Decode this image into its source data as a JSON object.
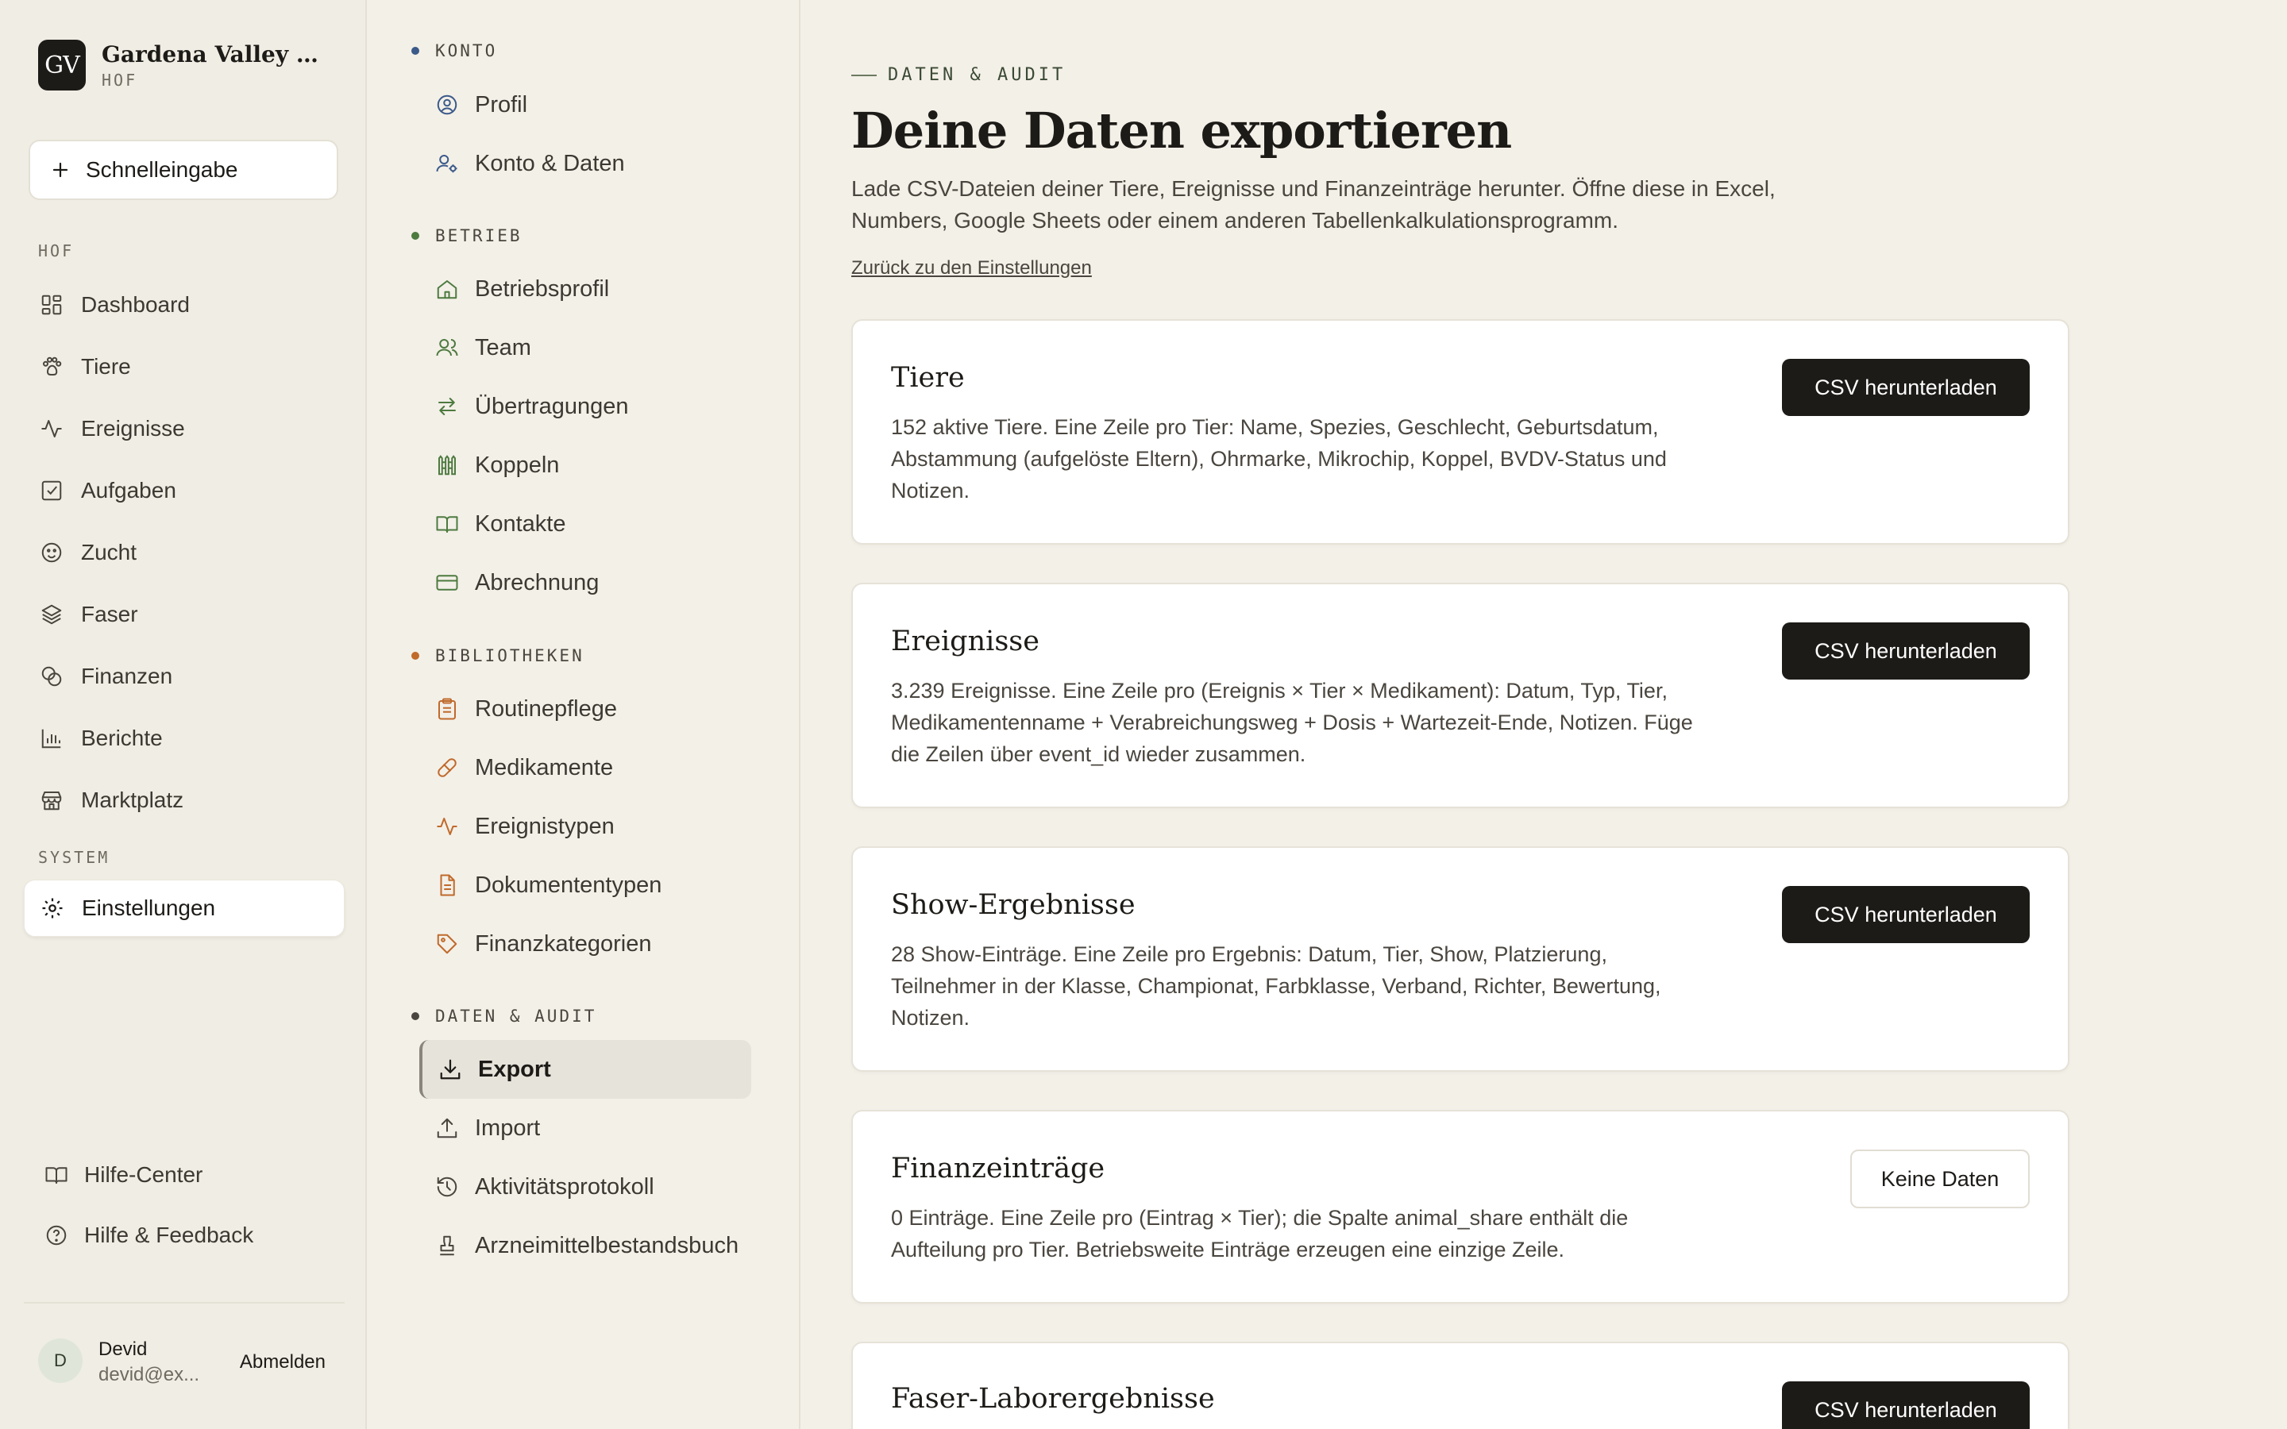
{
  "brand": {
    "initials": "GV",
    "name": "Gardena Valley Alp...",
    "subtitle": "HOF"
  },
  "quick_entry": "Schnelleingabe",
  "sidebar": {
    "section_farm": "HOF",
    "items": [
      {
        "label": "Dashboard",
        "icon": "dashboard-icon"
      },
      {
        "label": "Tiere",
        "icon": "paw-icon"
      },
      {
        "label": "Ereignisse",
        "icon": "activity-icon"
      },
      {
        "label": "Aufgaben",
        "icon": "checkbox-icon"
      },
      {
        "label": "Zucht",
        "icon": "breeding-icon"
      },
      {
        "label": "Faser",
        "icon": "layers-icon"
      },
      {
        "label": "Finanzen",
        "icon": "coins-icon"
      },
      {
        "label": "Berichte",
        "icon": "bar-chart-icon"
      },
      {
        "label": "Marktplatz",
        "icon": "store-icon"
      }
    ],
    "section_system": "SYSTEM",
    "settings": "Einstellungen",
    "help_center": "Hilfe-Center",
    "help_feedback": "Hilfe & Feedback",
    "user": {
      "initial": "D",
      "name": "Devid",
      "email": "devid@ex...",
      "logout": "Abmelden"
    }
  },
  "settings_nav": {
    "konto": {
      "title": "KONTO",
      "color": "#3b5a8a",
      "items": [
        "Profil",
        "Konto & Daten"
      ]
    },
    "betrieb": {
      "title": "BETRIEB",
      "color": "#4d7a3f",
      "items": [
        "Betriebsprofil",
        "Team",
        "Übertragungen",
        "Koppeln",
        "Kontakte",
        "Abrechnung"
      ]
    },
    "bibliotheken": {
      "title": "BIBLIOTHEKEN",
      "color": "#c06a2b",
      "items": [
        "Routinepflege",
        "Medikamente",
        "Ereignistypen",
        "Dokumententypen",
        "Finanzkategorien"
      ]
    },
    "daten": {
      "title": "DATEN & AUDIT",
      "color": "#4a463f",
      "items": [
        "Export",
        "Import",
        "Aktivitätsprotokoll",
        "Arzneimittelbestandsbuch"
      ]
    }
  },
  "main": {
    "eyebrow": "DATEN & AUDIT",
    "title": "Deine Daten exportieren",
    "description": "Lade CSV-Dateien deiner Tiere, Ereignisse und Finanzeinträge herunter. Öffne diese in Excel, Numbers, Google Sheets oder einem anderen Tabellenkalkulationsprogramm.",
    "back_link": "Zurück zu den Einstellungen",
    "cards": [
      {
        "title": "Tiere",
        "description": "152 aktive Tiere. Eine Zeile pro Tier: Name, Spezies, Geschlecht, Geburtsdatum, Abstammung (aufgelöste Eltern), Ohrmarke, Mikrochip, Koppel, BVDV-Status und Notizen.",
        "button": "CSV herunterladen"
      },
      {
        "title": "Ereignisse",
        "description": "3.239 Ereignisse. Eine Zeile pro (Ereignis × Tier × Medikament): Datum, Typ, Tier, Medikamentenname + Verabreichungsweg + Dosis + Wartezeit-Ende, Notizen. Füge die Zeilen über event_id wieder zusammen.",
        "button": "CSV herunterladen"
      },
      {
        "title": "Show-Ergebnisse",
        "description": "28 Show-Einträge. Eine Zeile pro Ergebnis: Datum, Tier, Show, Platzierung, Teilnehmer in der Klasse, Championat, Farbklasse, Verband, Richter, Bewertung, Notizen.",
        "button": "CSV herunterladen"
      },
      {
        "title": "Finanzeinträge",
        "description": "0 Einträge. Eine Zeile pro (Eintrag × Tier); die Spalte animal_share enthält die Aufteilung pro Tier. Betriebsweite Einträge erzeugen eine einzige Zeile.",
        "button": "Keine Daten"
      },
      {
        "title": "Faser-Laborergebnisse",
        "description": "",
        "button": "CSV herunterladen"
      }
    ]
  }
}
